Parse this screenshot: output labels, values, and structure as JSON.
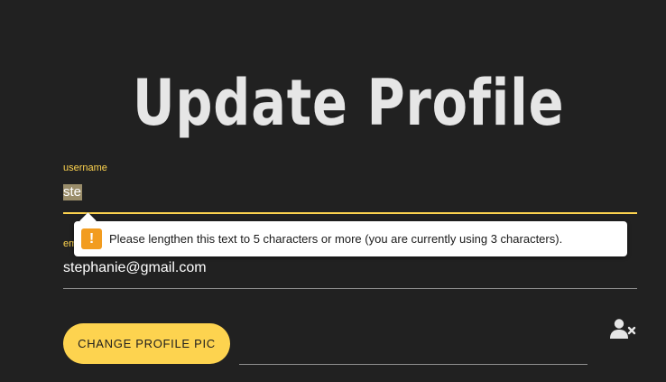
{
  "page": {
    "title": "Update Profile"
  },
  "form": {
    "username": {
      "label": "username",
      "value": "ste"
    },
    "email": {
      "label": "email",
      "value": "stephanie@gmail.com"
    },
    "validation_tooltip": {
      "icon": "warning-icon",
      "icon_glyph": "!",
      "message": "Please lengthen this text to 5 characters or more (you are currently using 3 characters)."
    },
    "change_pic_button": "CHANGE PROFILE PIC",
    "remove_user_icon": "user-remove-icon"
  },
  "colors": {
    "background": "#212121",
    "accent": "#fdd34f",
    "title": "#e6e6e6",
    "warning": "#f29c1f"
  }
}
